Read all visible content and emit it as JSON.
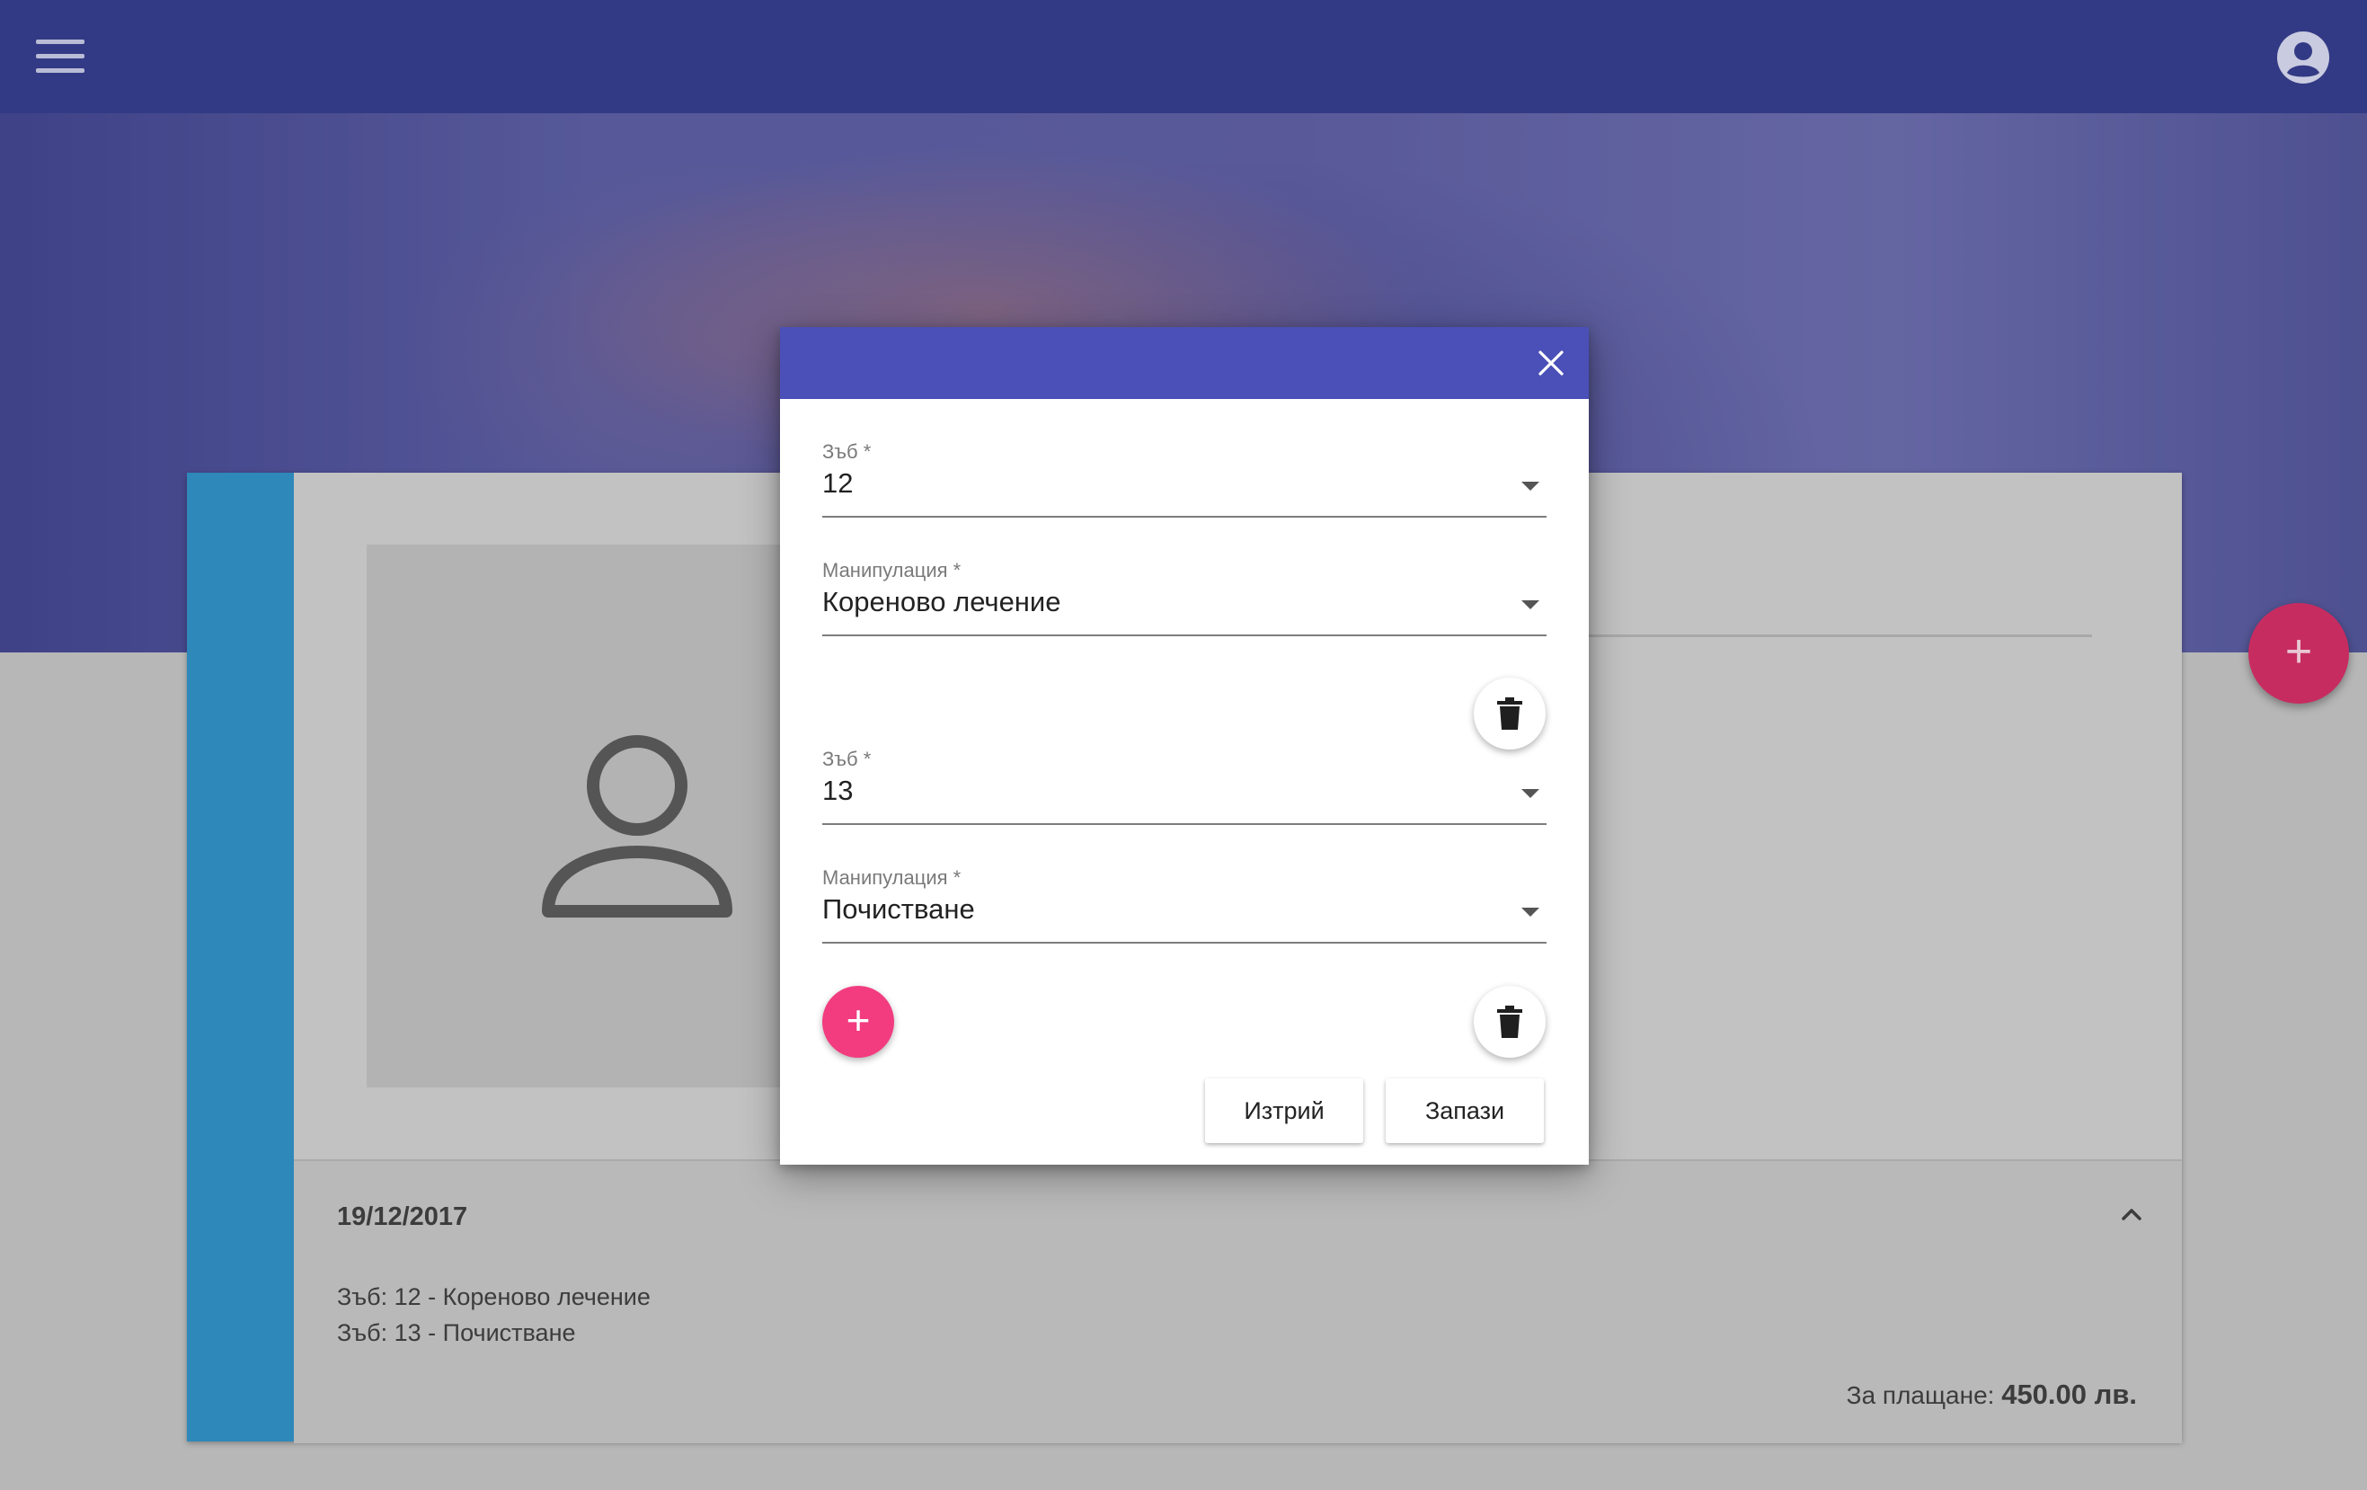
{
  "icons": {
    "menu": "menu-icon",
    "account": "account-circle-icon",
    "avatar": "person-outline-icon",
    "close": "close-icon",
    "delete": "trash-icon",
    "add": "plus-icon",
    "collapse": "chevron-up-icon"
  },
  "colors": {
    "topbar": "#333a85",
    "dialog_header": "#4a50b8",
    "card_accent": "#2f88ba",
    "fab": "#c72c60",
    "add_button": "#f23c7f"
  },
  "fab": {
    "label": "+"
  },
  "card": {
    "entry": {
      "date": "19/12/2017",
      "lines": [
        "Зъб: 12 - Кореново лечение",
        "Зъб: 13 - Почистване"
      ],
      "total_label": "За плащане:",
      "total_value": "450.00 лв."
    }
  },
  "dialog": {
    "rows": [
      {
        "tooth_label": "Зъб *",
        "tooth_value": "12",
        "manipulation_label": "Манипулация *",
        "manipulation_value": "Кореново лечение"
      },
      {
        "tooth_label": "Зъб *",
        "tooth_value": "13",
        "manipulation_label": "Манипулация *",
        "manipulation_value": "Почистване"
      }
    ],
    "add_label": "+",
    "delete_button": "Изтрий",
    "save_button": "Запази"
  }
}
